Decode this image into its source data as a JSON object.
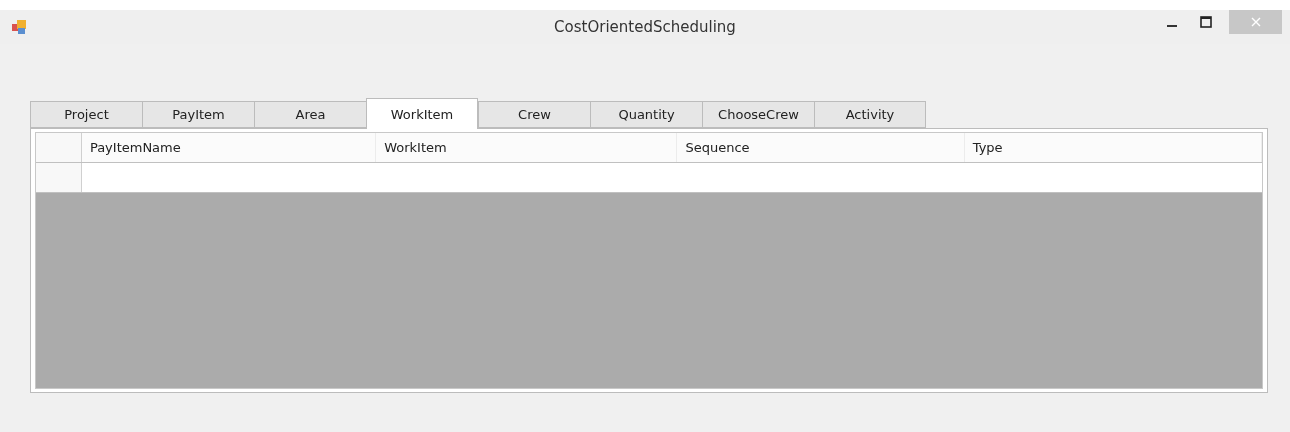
{
  "window": {
    "title": "CostOrientedScheduling"
  },
  "tabs": [
    {
      "label": "Project",
      "selected": false
    },
    {
      "label": "PayItem",
      "selected": false
    },
    {
      "label": "Area",
      "selected": false
    },
    {
      "label": "WorkItem",
      "selected": true
    },
    {
      "label": "Crew",
      "selected": false
    },
    {
      "label": "Quantity",
      "selected": false
    },
    {
      "label": "ChooseCrew",
      "selected": false
    },
    {
      "label": "Activity",
      "selected": false
    }
  ],
  "table": {
    "columns": [
      "PayItemName",
      "WorkItem",
      "Sequence",
      "Type"
    ]
  }
}
